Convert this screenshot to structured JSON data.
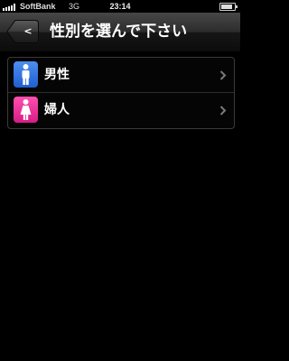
{
  "status_bar": {
    "carrier": "SoftBank",
    "network": "3G",
    "time": "23:14",
    "battery_level": 0.85
  },
  "nav": {
    "back_label": "<",
    "title": "性別を選んで下さい"
  },
  "rows": [
    {
      "label": "男性",
      "icon": "male-icon",
      "icon_color": "#2f6fe0"
    },
    {
      "label": "婦人",
      "icon": "female-icon",
      "icon_color": "#f0369c"
    }
  ],
  "colors": {
    "background": "#000000",
    "nav_bar": "#2c2c2c",
    "text": "#ffffff"
  }
}
